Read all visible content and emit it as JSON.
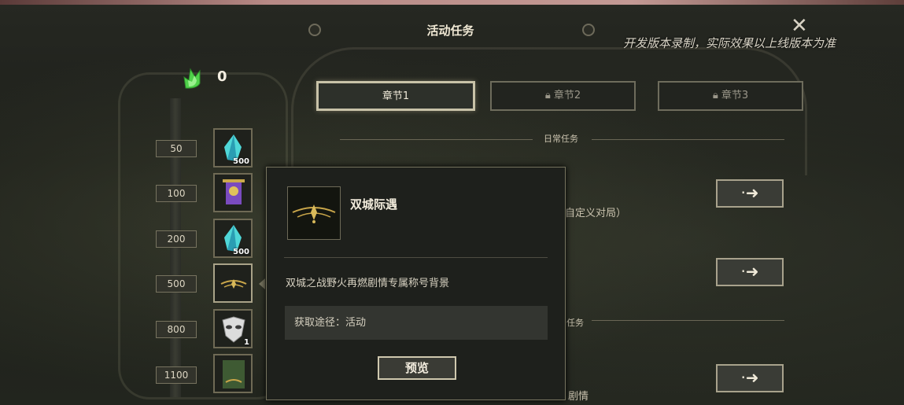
{
  "header": {
    "title": "活动任务",
    "watermark": "开发版本录制，实际效果以上线版本为准"
  },
  "currency": {
    "icon": "green-flame-icon",
    "value": "0"
  },
  "ladder": [
    {
      "tier": "50",
      "reward_icon": "crystal-icon",
      "qty": "500"
    },
    {
      "tier": "100",
      "reward_icon": "banner-icon",
      "qty": ""
    },
    {
      "tier": "200",
      "reward_icon": "crystal-icon",
      "qty": "500"
    },
    {
      "tier": "500",
      "reward_icon": "title-emblem-icon",
      "qty": ""
    },
    {
      "tier": "800",
      "reward_icon": "mask-icon",
      "qty": "1"
    },
    {
      "tier": "1100",
      "reward_icon": "green-card-icon",
      "qty": ""
    }
  ],
  "tabs": [
    {
      "label": "章节1",
      "locked": false
    },
    {
      "label": "章节2",
      "locked": true
    },
    {
      "label": "章节3",
      "locked": true
    }
  ],
  "sections": {
    "daily": "日常任务",
    "partial_custom": "自定义对局）",
    "partial_task": "任务",
    "partial_story": "剧情"
  },
  "popup": {
    "title": "双城际遇",
    "description": "双城之战野火再燃剧情专属称号背景",
    "source": "获取途径：活动",
    "preview_button": "预览"
  },
  "colors": {
    "accent": "#c8c2a8",
    "panel": "#1e201c",
    "currency_green": "#4fd14a"
  }
}
